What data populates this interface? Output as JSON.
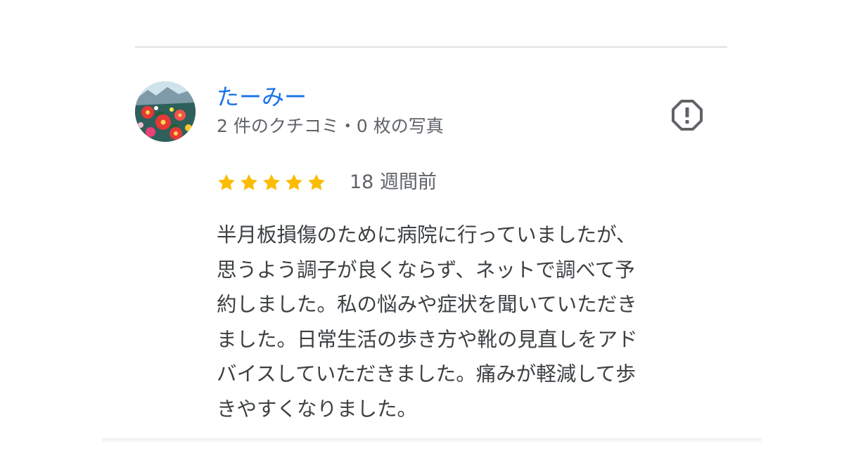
{
  "reviewer": {
    "name": "たーみー",
    "meta": "2 件のクチコミ・0 枚の写真"
  },
  "review": {
    "rating": 5,
    "rating_max": 5,
    "date": "18 週間前",
    "text_lines": [
      "半月板損傷のために病院に行っていましたが、",
      "思うよう調子が良くならず、ネットで調べて予",
      "約しました。私の悩みや症状を聞いていただき",
      "ました。日常生活の歩き方や靴の見直しをアド",
      "バイスしていただきました。痛みが軽減して歩",
      "きやすくなりました。"
    ]
  },
  "icons": {
    "report": "report-flag-icon",
    "star": "star-icon"
  },
  "colors": {
    "name_link": "#1a73e8",
    "star": "#fbbc04",
    "secondary_text": "#5f6368",
    "body_text": "#3c4043"
  }
}
